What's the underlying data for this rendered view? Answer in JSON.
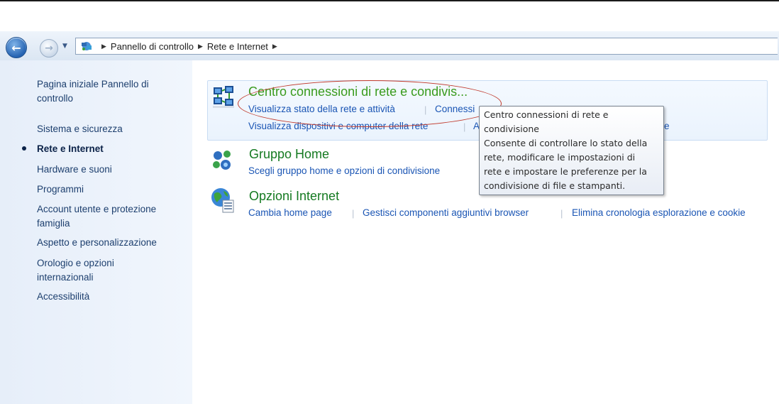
{
  "address_bar": {
    "breadcrumbs": [
      "Pannello di controllo",
      "Rete e Internet"
    ]
  },
  "sidebar": {
    "home_link": [
      "Pagina iniziale Pannello di",
      "controllo"
    ],
    "items": [
      {
        "label": "Sistema e sicurezza"
      },
      {
        "label": "Rete e Internet",
        "active": true
      },
      {
        "label": "Hardware e suoni"
      },
      {
        "label": "Programmi"
      },
      {
        "label": [
          "Account utente e protezione",
          "famiglia"
        ]
      },
      {
        "label": "Aspetto e personalizzazione"
      },
      {
        "label": [
          "Orologio e opzioni",
          "internazionali"
        ]
      },
      {
        "label": "Accessibilità"
      }
    ]
  },
  "categories": [
    {
      "title": "Centro connessioni di rete e condivis...",
      "icon": "network-center-icon",
      "tasks_row1": [
        "Visualizza stato della rete e attività",
        "Connessi"
      ],
      "tasks_row2": [
        "Visualizza dispositivi e computer della rete",
        "A",
        "e"
      ]
    },
    {
      "title": "Gruppo Home",
      "icon": "homegroup-icon",
      "tasks": [
        "Scegli gruppo home e opzioni di condivisione"
      ]
    },
    {
      "title": "Opzioni Internet",
      "icon": "internet-options-icon",
      "tasks": [
        "Cambia home page",
        "Gestisci componenti aggiuntivi browser",
        "Elimina cronologia esplorazione e cookie"
      ]
    }
  ],
  "tooltip": {
    "lines": [
      "Centro connessioni di rete e",
      "condivisione",
      "Consente di controllare lo stato della",
      "rete, modificare le impostazioni di",
      "rete e impostare le preferenze per la",
      "condivisione di file e stampanti."
    ]
  },
  "colors": {
    "link": "#1a55b4",
    "category_title": "#3a9b1d",
    "sidebar_bg": "#e6eef9",
    "annotation_ellipse": "#c0392b"
  }
}
